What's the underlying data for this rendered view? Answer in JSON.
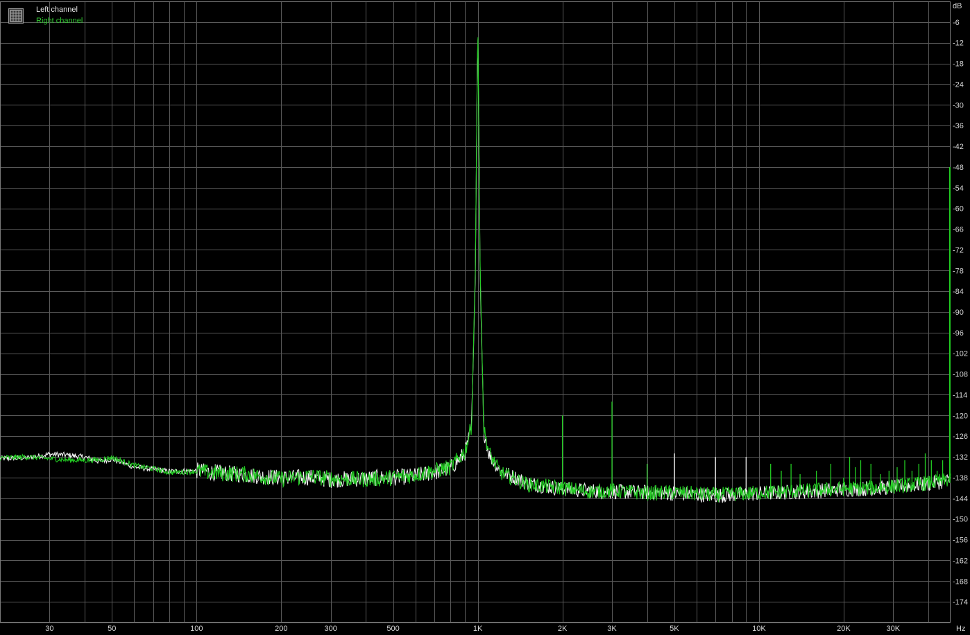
{
  "legend": {
    "left_label": "Left channel",
    "right_label": "Right channel"
  },
  "colors": {
    "background": "#000000",
    "grid": "#5a5a5a",
    "axis_text": "#d8d8d8",
    "left_series": "#f2f2f2",
    "right_series": "#22cc22"
  },
  "chart_data": {
    "type": "line",
    "title": "",
    "xlabel": "",
    "ylabel": "",
    "x_unit_label": "Hz",
    "y_unit_label": "dB",
    "x_scale": "log",
    "xlim": [
      20,
      48000
    ],
    "ylim": [
      -180,
      0
    ],
    "grid": true,
    "legend_position": "top-left",
    "x_ticks": [
      {
        "value": 30,
        "label": "30"
      },
      {
        "value": 50,
        "label": "50"
      },
      {
        "value": 100,
        "label": "100"
      },
      {
        "value": 200,
        "label": "200"
      },
      {
        "value": 300,
        "label": "300"
      },
      {
        "value": 500,
        "label": "500"
      },
      {
        "value": 1000,
        "label": "1K"
      },
      {
        "value": 2000,
        "label": "2K"
      },
      {
        "value": 3000,
        "label": "3K"
      },
      {
        "value": 5000,
        "label": "5K"
      },
      {
        "value": 10000,
        "label": "10K"
      },
      {
        "value": 20000,
        "label": "20K"
      },
      {
        "value": 30000,
        "label": "30K"
      }
    ],
    "y_ticks": [
      -6,
      -12,
      -18,
      -24,
      -30,
      -36,
      -42,
      -48,
      -54,
      -60,
      -66,
      -72,
      -78,
      -84,
      -90,
      -96,
      -102,
      -108,
      -114,
      -120,
      -126,
      -132,
      -138,
      -144,
      -150,
      -156,
      -162,
      -168,
      -174
    ],
    "series": [
      {
        "name": "Left channel",
        "color": "#f2f2f2",
        "points": [
          [
            20,
            -132.5
          ],
          [
            25,
            -132.3
          ],
          [
            30,
            -131.2
          ],
          [
            35,
            -131.5
          ],
          [
            40,
            -132.1
          ],
          [
            45,
            -133.3
          ],
          [
            50,
            -132.6
          ],
          [
            60,
            -134.9
          ],
          [
            70,
            -135.6
          ],
          [
            80,
            -136.2
          ],
          [
            100,
            -136.0
          ],
          [
            120,
            -136.6
          ],
          [
            150,
            -137.2
          ],
          [
            200,
            -138.1
          ],
          [
            250,
            -137.9
          ],
          [
            300,
            -138.6
          ],
          [
            400,
            -138.2
          ],
          [
            500,
            -138.0
          ],
          [
            600,
            -137.5
          ],
          [
            700,
            -136.5
          ],
          [
            800,
            -135.3
          ],
          [
            900,
            -131.0
          ],
          [
            950,
            -124.0
          ],
          [
            980,
            -80.0
          ],
          [
            1000,
            -4.0
          ],
          [
            1020,
            -80.0
          ],
          [
            1050,
            -124.5
          ],
          [
            1100,
            -131.5
          ],
          [
            1200,
            -136.0
          ],
          [
            1500,
            -139.6
          ],
          [
            2000,
            -141.3
          ],
          [
            2500,
            -141.8
          ],
          [
            3000,
            -142.0
          ],
          [
            4000,
            -142.3
          ],
          [
            5000,
            -142.6
          ],
          [
            7000,
            -143.2
          ],
          [
            10000,
            -142.6
          ],
          [
            15000,
            -142.0
          ],
          [
            20000,
            -141.4
          ],
          [
            25000,
            -141.2
          ],
          [
            30000,
            -140.8
          ],
          [
            40000,
            -139.8
          ],
          [
            48000,
            -138.8
          ]
        ]
      },
      {
        "name": "Right channel",
        "color": "#22cc22",
        "points": [
          [
            20,
            -132.3
          ],
          [
            25,
            -132.0
          ],
          [
            30,
            -132.5
          ],
          [
            35,
            -132.9
          ],
          [
            40,
            -133.0
          ],
          [
            45,
            -132.8
          ],
          [
            50,
            -132.2
          ],
          [
            60,
            -134.5
          ],
          [
            70,
            -135.4
          ],
          [
            80,
            -136.5
          ],
          [
            100,
            -136.2
          ],
          [
            120,
            -136.8
          ],
          [
            150,
            -137.0
          ],
          [
            200,
            -138.4
          ],
          [
            250,
            -137.6
          ],
          [
            300,
            -138.3
          ],
          [
            400,
            -138.5
          ],
          [
            500,
            -138.0
          ],
          [
            600,
            -137.2
          ],
          [
            700,
            -136.0
          ],
          [
            800,
            -135.0
          ],
          [
            900,
            -130.5
          ],
          [
            950,
            -123.0
          ],
          [
            980,
            -78.0
          ],
          [
            1000,
            -3.5
          ],
          [
            1020,
            -78.0
          ],
          [
            1050,
            -124.0
          ],
          [
            1100,
            -131.0
          ],
          [
            1200,
            -136.5
          ],
          [
            1500,
            -140.0
          ],
          [
            2000,
            -141.0
          ],
          [
            2500,
            -142.0
          ],
          [
            3000,
            -141.8
          ],
          [
            4000,
            -142.5
          ],
          [
            5000,
            -142.3
          ],
          [
            7000,
            -143.0
          ],
          [
            10000,
            -142.4
          ],
          [
            15000,
            -141.8
          ],
          [
            20000,
            -141.2
          ],
          [
            25000,
            -141.0
          ],
          [
            30000,
            -140.6
          ],
          [
            40000,
            -139.6
          ],
          [
            48000,
            -138.5
          ]
        ]
      }
    ],
    "harmonic_spikes": [
      {
        "series": "Right channel",
        "x": 2000,
        "y": -120
      },
      {
        "series": "Right channel",
        "x": 3000,
        "y": -116
      },
      {
        "series": "Right channel",
        "x": 4000,
        "y": -134
      },
      {
        "series": "Left channel",
        "x": 5000,
        "y": -131
      },
      {
        "series": "Left channel",
        "x": 7000,
        "y": -132
      },
      {
        "series": "Left channel",
        "x": 9000,
        "y": -132
      },
      {
        "series": "Right channel",
        "x": 11000,
        "y": -134
      },
      {
        "series": "Right channel",
        "x": 12000,
        "y": -136
      },
      {
        "series": "Right channel",
        "x": 13000,
        "y": -134
      },
      {
        "series": "Right channel",
        "x": 14000,
        "y": -137
      },
      {
        "series": "Right channel",
        "x": 16000,
        "y": -136
      },
      {
        "series": "Right channel",
        "x": 18000,
        "y": -134
      },
      {
        "series": "Right channel",
        "x": 20000,
        "y": -138
      },
      {
        "series": "Right channel",
        "x": 21000,
        "y": -132
      },
      {
        "series": "Right channel",
        "x": 22000,
        "y": -135
      },
      {
        "series": "Right channel",
        "x": 23000,
        "y": -133
      },
      {
        "series": "Right channel",
        "x": 25000,
        "y": -134
      },
      {
        "series": "Right channel",
        "x": 27000,
        "y": -137
      },
      {
        "series": "Right channel",
        "x": 29000,
        "y": -136
      },
      {
        "series": "Right channel",
        "x": 31000,
        "y": -135
      },
      {
        "series": "Right channel",
        "x": 33000,
        "y": -133
      },
      {
        "series": "Right channel",
        "x": 35000,
        "y": -136
      },
      {
        "series": "Right channel",
        "x": 37000,
        "y": -134
      },
      {
        "series": "Right channel",
        "x": 39000,
        "y": -131
      },
      {
        "series": "Right channel",
        "x": 41000,
        "y": -133
      },
      {
        "series": "Right channel",
        "x": 43000,
        "y": -136
      },
      {
        "series": "Right channel",
        "x": 45000,
        "y": -133
      }
    ]
  }
}
